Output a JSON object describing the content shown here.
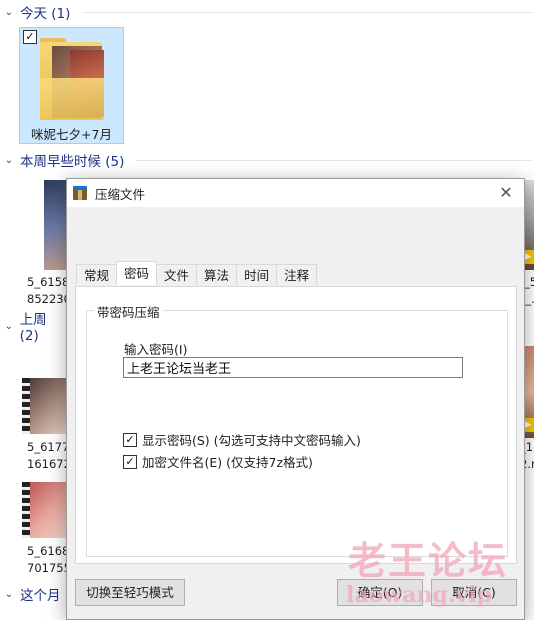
{
  "explorer": {
    "groups": [
      {
        "label": "今天 (1)"
      },
      {
        "label": "本周早些时候 (5)"
      },
      {
        "label": "上周 (2)"
      },
      {
        "label": "这个月"
      }
    ],
    "selected_item": {
      "label": "咪妮七夕+7月"
    },
    "files": [
      {
        "line1": "5_6158",
        "line2": "852230"
      },
      {
        "line1": "5_6177",
        "line2": "161672"
      },
      {
        "line1": "5_6168",
        "line2": "701755"
      }
    ],
    "right_labels": [
      "_5",
      "5_.",
      "2.n",
      "_18",
      "2.n"
    ]
  },
  "dialog": {
    "title": "压缩文件",
    "tabs": [
      "常规",
      "密码",
      "文件",
      "算法",
      "时间",
      "注释"
    ],
    "active_tab": "密码",
    "group_title": "带密码压缩",
    "password_label": "输入密码(I)",
    "password_value": "上老王论坛当老王",
    "show_password": {
      "label": "显示密码(S) (勾选可支持中文密码输入)",
      "checked": true
    },
    "encrypt_names": {
      "label": "加密文件名(E) (仅支持7z格式)",
      "checked": true
    },
    "buttons": {
      "switch_mode": "切换至轻巧模式",
      "ok": "确定(O)",
      "cancel": "取消(C)"
    }
  },
  "watermark": {
    "line1": "老王论坛",
    "line2": "laowang.vip"
  }
}
